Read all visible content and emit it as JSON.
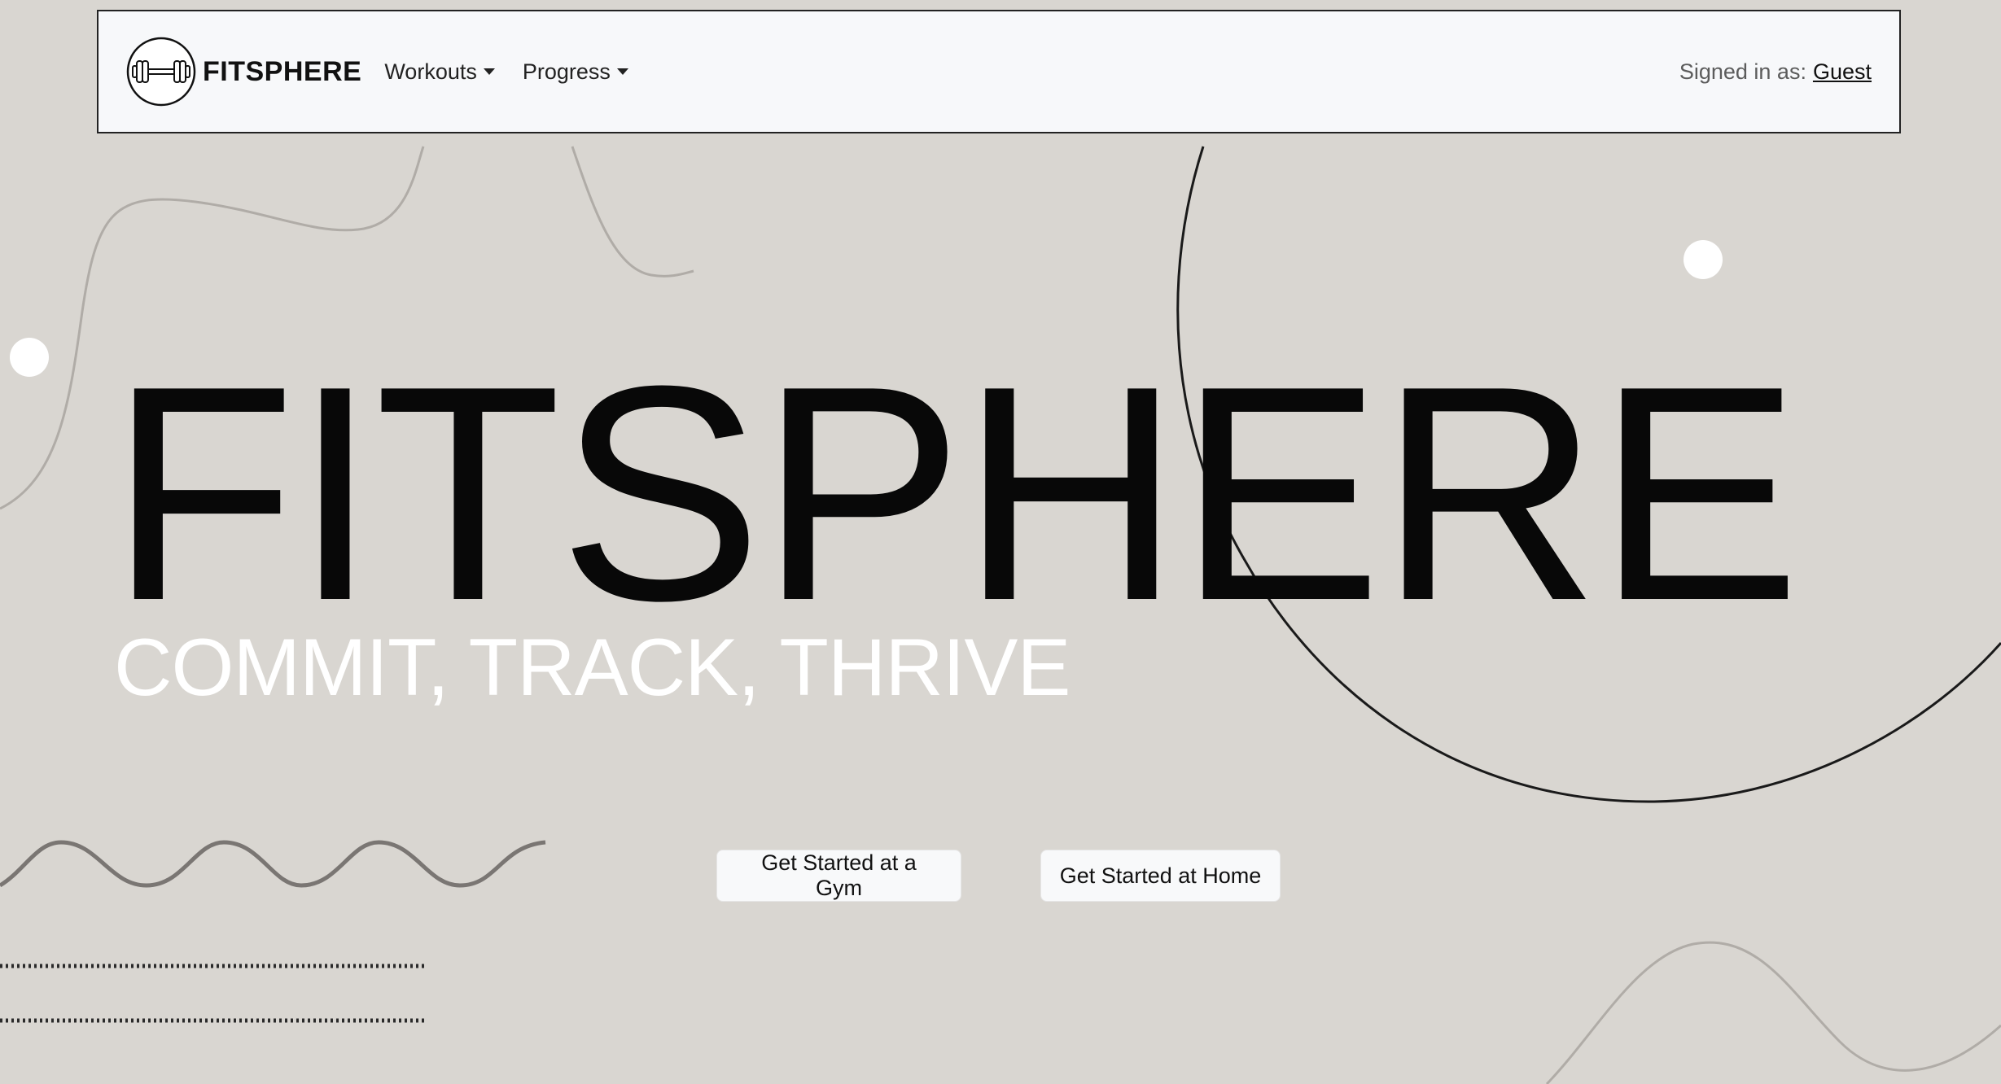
{
  "navbar": {
    "brand_name": "FITSPHERE",
    "logo_icon": "dumbbell-icon",
    "menu": [
      {
        "label": "Workouts",
        "has_dropdown": true
      },
      {
        "label": "Progress",
        "has_dropdown": true
      }
    ],
    "signed_in_label": "Signed in as:",
    "signed_in_user": "Guest"
  },
  "hero": {
    "title": "FITSPHERE",
    "tagline": "COMMIT, TRACK, THRIVE",
    "buttons": {
      "gym": "Get Started at a Gym",
      "home": "Get Started at Home"
    }
  },
  "colors": {
    "background": "#d9d6d1",
    "navbar_background": "#f7f8fa",
    "title": "#080808",
    "tagline": "#ffffff",
    "button_background": "#f8f9fa"
  }
}
